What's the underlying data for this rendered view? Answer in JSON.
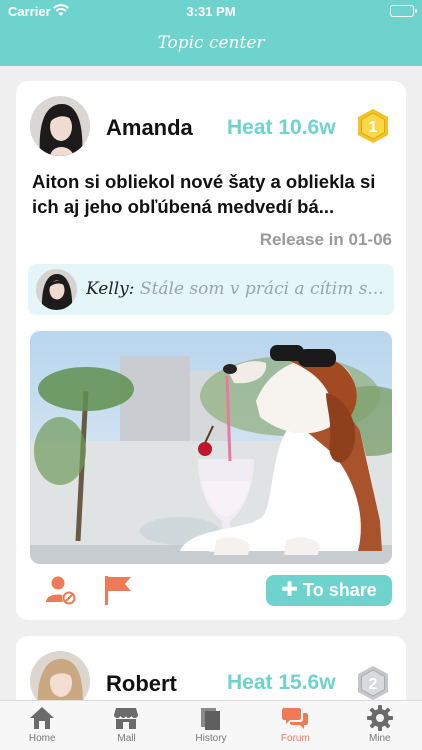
{
  "status_bar": {
    "carrier": "Carrier",
    "time": "3:31 PM"
  },
  "header": {
    "title": "Topic center"
  },
  "colors": {
    "accent": "#6fd3cd",
    "orange": "#ee7a57",
    "gray_text": "#9a9a9a",
    "comment_bg": "#e4f6f8"
  },
  "posts": [
    {
      "author": "Amanda",
      "heat": "Heat 10.6w",
      "rank": "1",
      "title": "Aiton si obliekol nové šaty a obliekla si ich aj jeho obľúbená medvedí bá...",
      "release": "Release in 01-06",
      "comment": {
        "author": "Kelly:",
        "text": "Stále som v práci a cítim s..."
      },
      "image_icon": "beagle-with-sunglasses-photo",
      "share_label": "To share",
      "share_icon": "plus-icon"
    },
    {
      "author": "Robert",
      "heat": "Heat 15.6w",
      "rank": "2"
    }
  ],
  "tabbar": [
    {
      "label": "Home",
      "icon": "home-icon"
    },
    {
      "label": "Mall",
      "icon": "store-icon"
    },
    {
      "label": "History",
      "icon": "history-icon"
    },
    {
      "label": "Forum",
      "icon": "forum-icon",
      "active": true
    },
    {
      "label": "Mine",
      "icon": "gear-icon"
    }
  ]
}
